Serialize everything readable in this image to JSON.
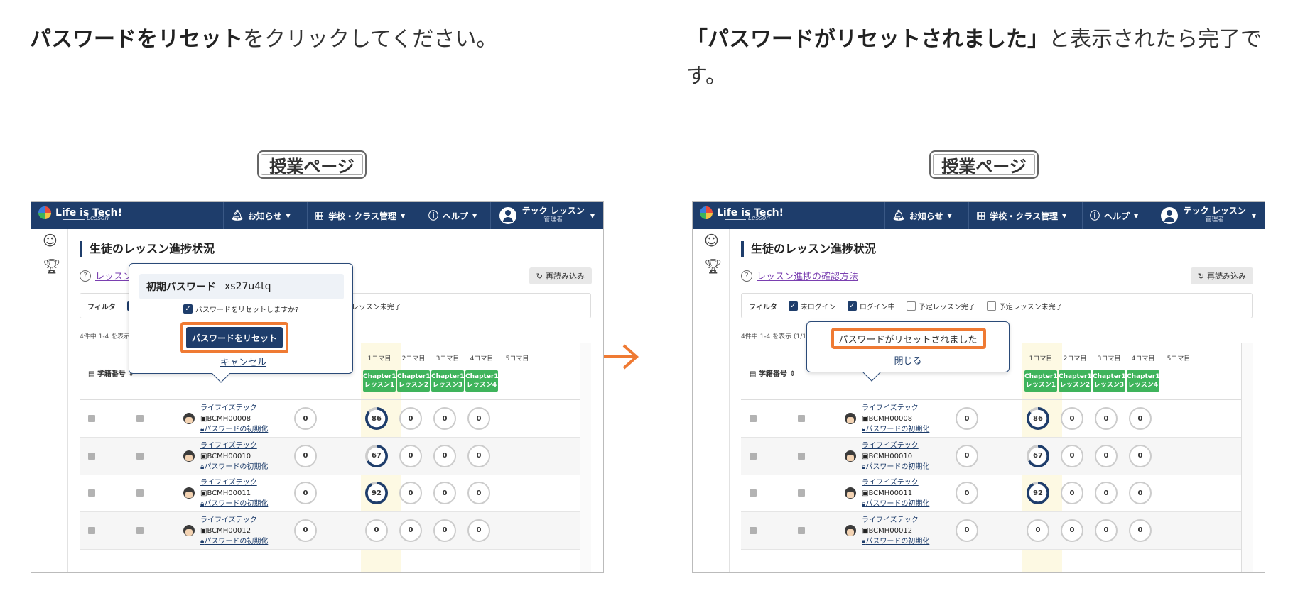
{
  "instructions": {
    "left_bold": "パスワードをリセット",
    "left_rest": "をクリックしてください。",
    "right_bold": "「パスワードがリセットされました」",
    "right_rest": "と表示されたら完了です。"
  },
  "page_tag": "授業ページ",
  "app": {
    "logo_text": "Life is Tech!",
    "logo_sub": "Lesson",
    "nav": {
      "news": "お知らせ",
      "school": "学校・クラス管理",
      "help": "ヘルプ"
    },
    "user_name": "テック レッスン",
    "user_role": "管理者"
  },
  "page": {
    "title": "生徒のレッスン進捗状況",
    "howto_link": "レッスン進捗の確認方法",
    "reload": "再読み込み",
    "filter_label": "フィルタ",
    "filters": [
      "未ログイン",
      "ログイン中",
      "予定レッスン完了",
      "予定レッスン未完了"
    ],
    "count": "4件中 1-4 を表示 (1/1)",
    "col_id": "学籍番号 ⇕",
    "period_headers": [
      "1コマ目",
      "2コマ目",
      "3コマ目",
      "4コマ目",
      "5コマ目"
    ],
    "chips": [
      {
        "line1": "Chapter1",
        "line2": "レッスン1"
      },
      {
        "line1": "Chapter1",
        "line2": "レッスン2"
      },
      {
        "line1": "Chapter1",
        "line2": "レッスン3"
      },
      {
        "line1": "Chapter1",
        "line2": "レッスン4"
      }
    ],
    "rows": [
      {
        "name": "ライフイズテック",
        "id": "BCMH00008",
        "reset": "パスワードの初期化",
        "values": [
          "0",
          "86",
          "0",
          "0",
          "0"
        ],
        "progress": 0.86
      },
      {
        "name": "ライフイズテック",
        "id": "BCMH00010",
        "reset": "パスワードの初期化",
        "values": [
          "0",
          "67",
          "0",
          "0",
          "0"
        ],
        "progress": 0.67
      },
      {
        "name": "ライフイズテック",
        "id": "BCMH00011",
        "reset": "パスワードの初期化",
        "values": [
          "0",
          "92",
          "0",
          "0",
          "0"
        ],
        "progress": 0.92
      },
      {
        "name": "ライフイズテック",
        "id": "BCMH00012",
        "reset": "パスワードの初期化",
        "values": [
          "0",
          "0",
          "0",
          "0",
          "0"
        ],
        "progress": 0
      }
    ]
  },
  "popover_reset": {
    "pw_label": "初期パスワード",
    "pw_value": "xs27u4tq",
    "confirm": "パスワードをリセットしますか?",
    "button": "パスワードをリセット",
    "cancel": "キャンセル"
  },
  "popover_done": {
    "message": "パスワードがリセットされました",
    "close": "閉じる"
  },
  "colors": {
    "brand": "#1e3d6b",
    "highlight": "#ef7a33",
    "chip": "#3fb45c"
  }
}
